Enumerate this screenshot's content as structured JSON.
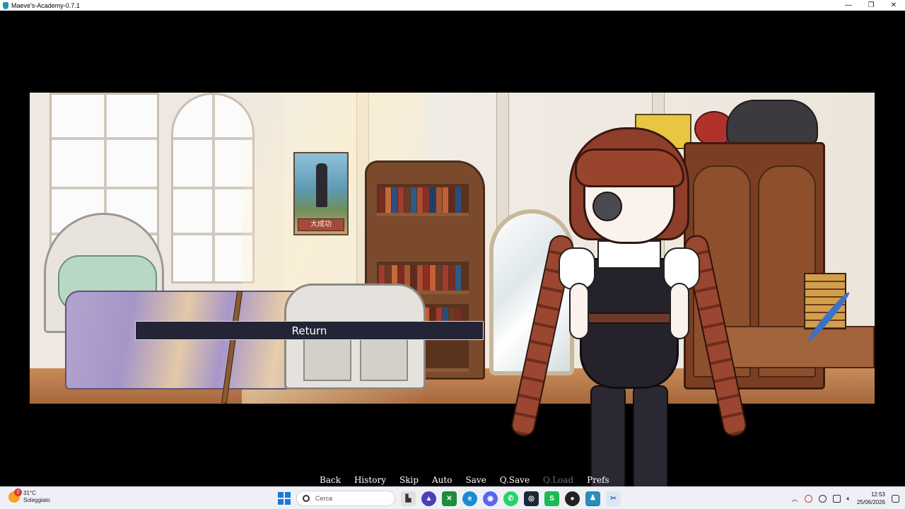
{
  "window": {
    "title": "Maeve's-Academy-0.7.1",
    "controls": {
      "minimize": "—",
      "maximize": "❐",
      "close": "✕"
    }
  },
  "scene": {
    "poster_text": "大成功"
  },
  "menu": {
    "return_label": "Return"
  },
  "quick_menu": {
    "items": [
      {
        "label": "Back",
        "enabled": true
      },
      {
        "label": "History",
        "enabled": true
      },
      {
        "label": "Skip",
        "enabled": true
      },
      {
        "label": "Auto",
        "enabled": true
      },
      {
        "label": "Save",
        "enabled": true
      },
      {
        "label": "Q.Save",
        "enabled": true
      },
      {
        "label": "Q.Load",
        "enabled": false
      },
      {
        "label": "Prefs",
        "enabled": true
      }
    ]
  },
  "taskbar": {
    "weather": {
      "temperature": "31°C",
      "condition": "Soleggiato",
      "badge": "2"
    },
    "search_placeholder": "Cerca",
    "pinned_apps": [
      "file-explorer-icon",
      "proton-vpn-icon",
      "xbox-icon",
      "edge-icon",
      "discord-icon",
      "whatsapp-icon",
      "steam-icon",
      "spotify-icon",
      "obs-icon",
      "game-icon",
      "snipping-tool-icon"
    ],
    "clock": {
      "time": "12:53",
      "date": "25/06/2026"
    }
  }
}
